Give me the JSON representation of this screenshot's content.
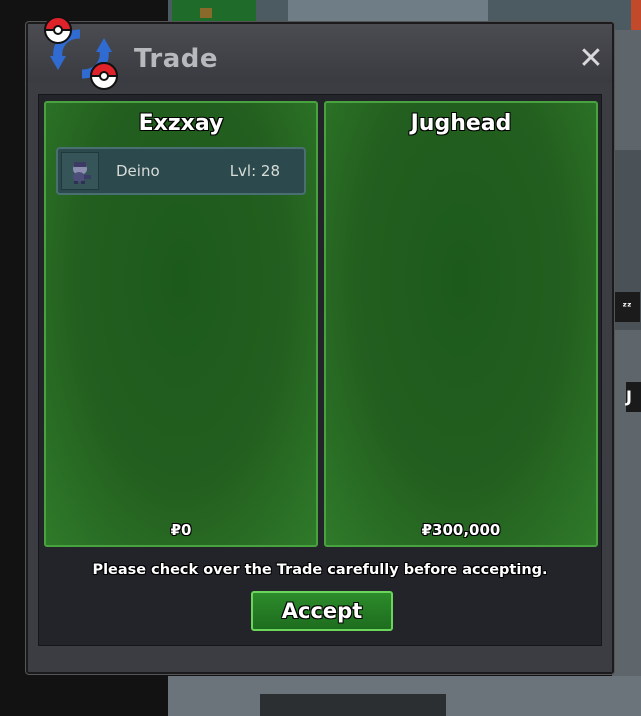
{
  "window": {
    "title": "Trade",
    "close_icon": "close-icon"
  },
  "left_panel": {
    "name": "Exzxay",
    "items": [
      {
        "name": "Deino",
        "level": "Lvl: 28",
        "icon": "deino-sprite-icon"
      }
    ],
    "money": "₽0"
  },
  "right_panel": {
    "name": "Jughead",
    "items": [],
    "money": "₽300,000"
  },
  "notice": "Please check over the Trade carefully before accepting.",
  "accept_label": "Accept",
  "colors": {
    "panel_green": "#235f1f",
    "panel_border": "#48a23d",
    "button_green": "#2c8b2a",
    "window_bg": "#3c3d42"
  }
}
